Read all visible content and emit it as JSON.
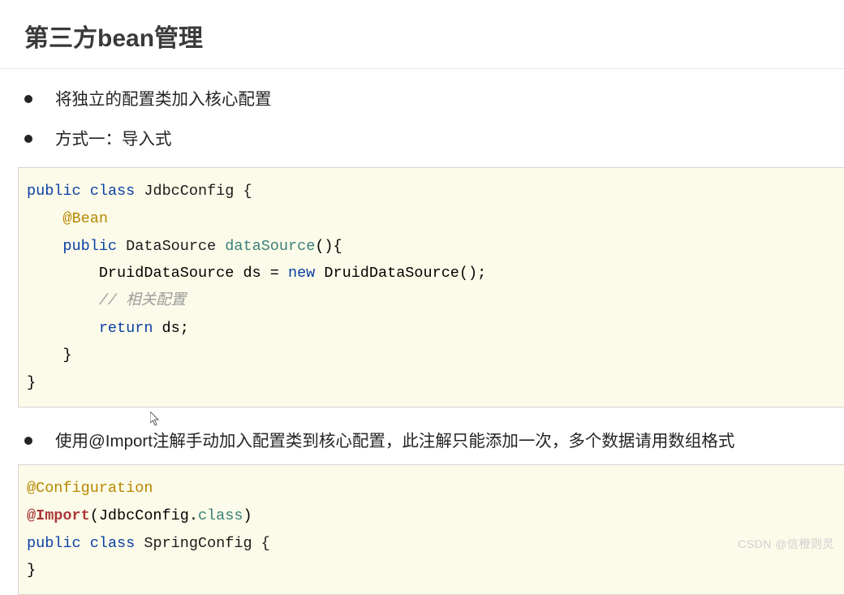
{
  "heading": "第三方bean管理",
  "bullets": [
    "将独立的配置类加入核心配置",
    "方式一：导入式",
    "使用@Import注解手动加入配置类到核心配置，此注解只能添加一次，多个数据请用数组格式"
  ],
  "code1": {
    "line1_public": "public",
    "line1_class": "class",
    "line1_name": "JdbcConfig {",
    "line2_annotation": "@Bean",
    "line3_public": "public",
    "line3_type": "DataSource",
    "line3_method": "dataSource",
    "line3_end": "(){",
    "line4_a": "DruidDataSource ds = ",
    "line4_new": "new",
    "line4_b": " DruidDataSource();",
    "line5_comment": "// 相关配置",
    "line6_return": "return",
    "line6_end": " ds;",
    "line7": "    }",
    "line8": "}"
  },
  "code2": {
    "line1_annotation": "@Configuration",
    "line2_import": "@Import",
    "line2_a": "(JdbcConfig.",
    "line2_class": "class",
    "line2_b": ")",
    "line3_public": "public",
    "line3_class": "class",
    "line3_name": "SpringConfig {",
    "line4": "}"
  },
  "watermark": "CSDN @信橙则灵"
}
